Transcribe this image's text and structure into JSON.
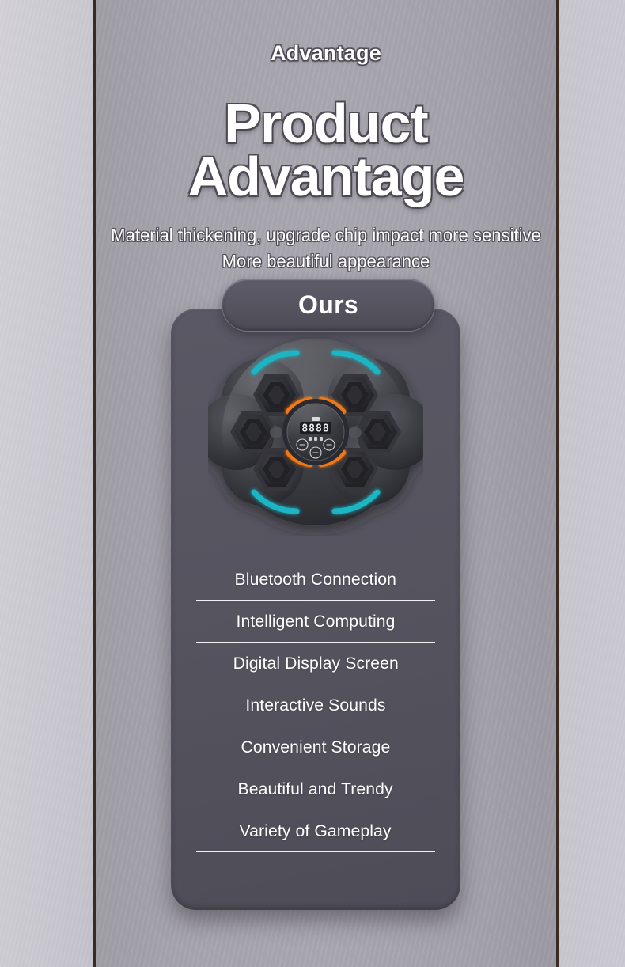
{
  "header": {
    "eyebrow": "Advantage",
    "title": "Product Advantage",
    "subtitle_line1": "Material thickening, upgrade chip impact more sensitive",
    "subtitle_line2": "More beautiful appearance"
  },
  "card": {
    "badge_label": "Ours",
    "features": [
      {
        "label": "Bluetooth Connection"
      },
      {
        "label": "Intelligent Computing"
      },
      {
        "label": "Digital Display Screen"
      },
      {
        "label": "Interactive Sounds"
      },
      {
        "label": "Convenient Storage"
      },
      {
        "label": "Beautiful and Trendy"
      },
      {
        "label": "Variety of Gameplay"
      }
    ]
  },
  "device": {
    "name": "music-boxing-machine",
    "display_value": "8888",
    "pad_count": 6,
    "button_count": 3,
    "accent_cyan": "#1fb5c4",
    "accent_orange": "#f07818",
    "body_color": "#2e2f33"
  },
  "colors": {
    "wall": "#c2c0c8",
    "panel": "#a6a4ac",
    "panel_border": "#3a2a22",
    "card": "#56545f",
    "badge": "#56545f",
    "divider": "#f2f1f5",
    "text": "#ffffff"
  }
}
